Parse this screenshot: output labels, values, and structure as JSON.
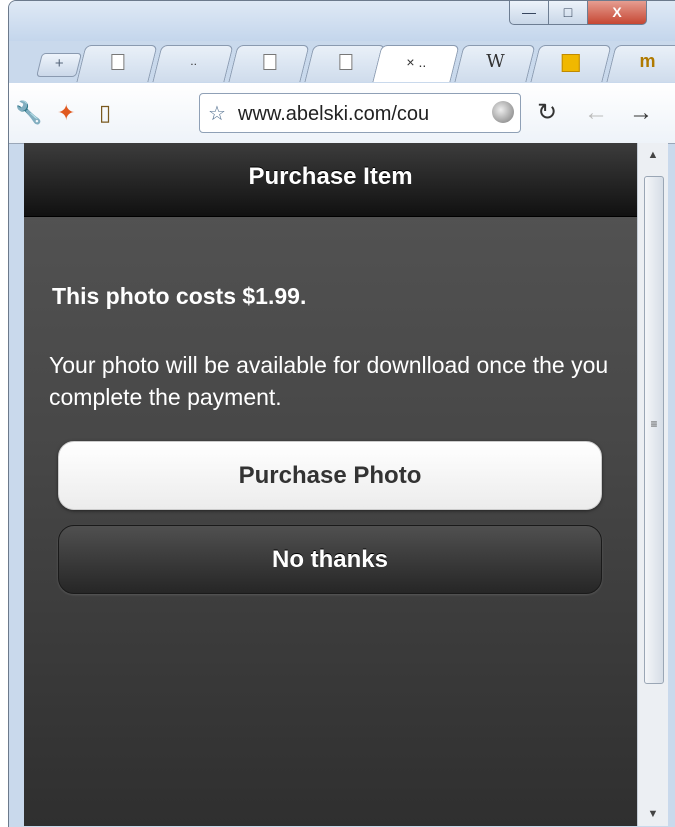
{
  "window": {
    "minimize_label": "—",
    "maximize_label": "□",
    "close_label": "X"
  },
  "tabs": [
    {
      "label": "",
      "icon": "page-icon"
    },
    {
      "label": "..",
      "icon": "page-icon"
    },
    {
      "label": "",
      "icon": "page-icon"
    },
    {
      "label": "",
      "icon": "page-icon"
    },
    {
      "label": "×  ..",
      "icon": "close-icon",
      "active": true
    },
    {
      "label": "W",
      "icon": "wikipedia-icon"
    },
    {
      "label": "",
      "icon": "yellow-square-icon"
    },
    {
      "label": "m",
      "icon": "favicon-icon"
    }
  ],
  "newtab_label": "+",
  "toolbar": {
    "url": "www.abelski.com/cou",
    "reload_glyph": "↻",
    "back_glyph": "←",
    "forward_glyph": "→"
  },
  "page": {
    "header_title": "Purchase Item",
    "cost_text": "This photo costs $1.99.",
    "description": "Your photo will be available for downlload once the you complete the payment.",
    "purchase_button": "Purchase Photo",
    "no_thanks_button": "No thanks"
  },
  "scrollbar": {
    "up_glyph": "▲",
    "down_glyph": "▼",
    "grip_glyph": "≡"
  },
  "colors": {
    "header_bg": "#111111",
    "page_bg": "#474747",
    "purchase_button_bg": "#ffffff",
    "no_button_bg": "#303030"
  }
}
